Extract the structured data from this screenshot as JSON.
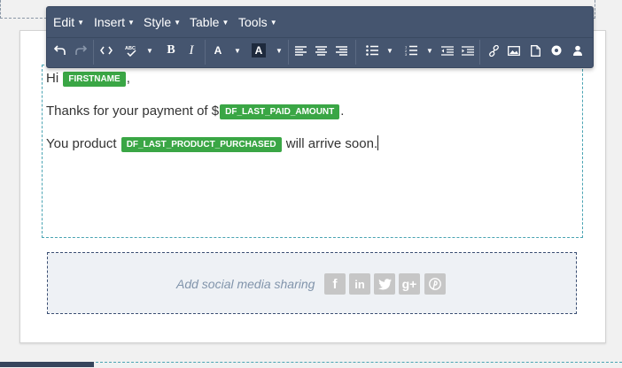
{
  "menubar": {
    "items": [
      {
        "label": "Edit"
      },
      {
        "label": "Insert"
      },
      {
        "label": "Style"
      },
      {
        "label": "Table"
      },
      {
        "label": "Tools"
      }
    ]
  },
  "toolbar": {
    "icons": [
      "undo-icon",
      "redo-icon",
      "source-code-icon",
      "spellcheck-icon",
      "bold-icon",
      "italic-icon",
      "text-color-icon",
      "background-color-icon",
      "align-left-icon",
      "align-center-icon",
      "align-right-icon",
      "bullet-list-icon",
      "numbered-list-icon",
      "outdent-icon",
      "indent-icon",
      "link-icon",
      "image-icon",
      "file-icon",
      "special-char-icon",
      "user-icon"
    ],
    "bold_label": "B",
    "italic_label": "I",
    "text_color_label": "A",
    "bg_color_label": "A"
  },
  "editor": {
    "line1": {
      "text": "Hi ",
      "tag": "FIRSTNAME",
      "after": ","
    },
    "line2": {
      "text": "Thanks for your payment of $",
      "tag": "DF_LAST_PAID_AMOUNT",
      "after": "."
    },
    "line3": {
      "text": "You product ",
      "tag": "DF_LAST_PRODUCT_PURCHASED",
      "after": " will arrive soon."
    },
    "tag_color": "#3aa645"
  },
  "social": {
    "label": "Add social media sharing",
    "icons": [
      {
        "name": "facebook-icon",
        "glyph": "f"
      },
      {
        "name": "linkedin-icon",
        "glyph": "in"
      },
      {
        "name": "twitter-icon",
        "glyph": ""
      },
      {
        "name": "google-plus-icon",
        "glyph": "g+"
      },
      {
        "name": "pinterest-icon",
        "glyph": "P"
      }
    ]
  },
  "colors": {
    "toolbar_bg": "#45556f",
    "tag_green": "#3aa645",
    "dash_teal": "#4aa4b3"
  }
}
